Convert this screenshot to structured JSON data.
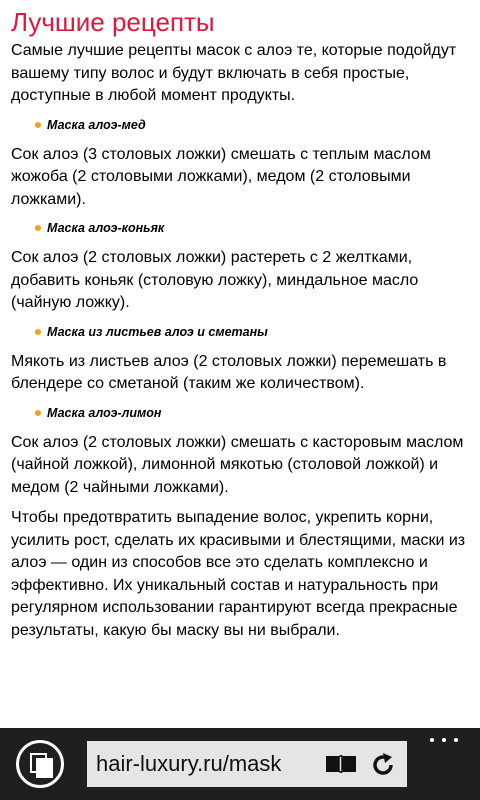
{
  "article": {
    "heading": "Лучшие рецепты",
    "intro": "Самые лучшие рецепты масок с алоэ те, которые подойдут вашему типу волос и будут включать в себя простые, доступные в любой момент продукты.",
    "recipes": [
      {
        "title": "Маска алоэ-мед",
        "text": "Сок алоэ (3 столовых ложки) смешать с теплым маслом жожоба (2 столовыми ложками), медом (2 столовыми ложками)."
      },
      {
        "title": "Маска алоэ-коньяк",
        "text": "Сок алоэ (2 столовых ложки) растереть с 2 желтками, добавить коньяк (столовую ложку), миндальное масло (чайную ложку)."
      },
      {
        "title": "Маска из листьев алоэ и сметаны",
        "text": "Мякоть из листьев алоэ (2 столовых ложки) перемешать в блендере со сметаной (таким же количеством)."
      },
      {
        "title": "Маска алоэ-лимон",
        "text": "Сок алоэ (2 столовых ложки) смешать с касторовым маслом (чайной ложкой), лимонной мякотью (столовой ложкой) и медом (2 чайными ложками)."
      }
    ],
    "conclusion": "Чтобы предотвратить выпадение волос, укрепить корни, усилить рост, сделать их красивыми и блестящими, маски из алоэ — один из способов все это сделать комплексно и эффективно. Их уникальный состав и натуральность при регулярном использовании гарантируют всегда прекрасные результаты, какую бы маску вы ни выбрали."
  },
  "browser": {
    "url": "hair-luxury.ru/mask",
    "icons": [
      "tabs-icon",
      "reader-view-icon",
      "refresh-icon",
      "more-icon"
    ]
  },
  "colors": {
    "heading": "#e0163c",
    "bullet": "#f2a020",
    "browser_bar": "#1f1f1f",
    "address_bar": "#e5e5e5"
  }
}
